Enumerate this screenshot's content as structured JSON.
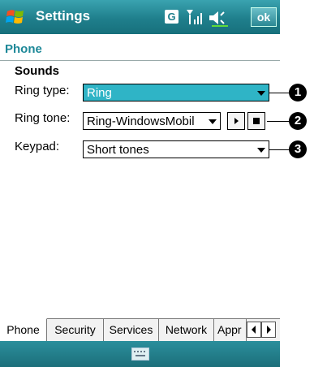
{
  "titlebar": {
    "title": "Settings",
    "g_indicator": "G",
    "ok_label": "ok",
    "icons": [
      "windows-start-icon",
      "signal-icon",
      "volume-icon"
    ]
  },
  "page": {
    "title": "Phone",
    "section": "Sounds"
  },
  "fields": {
    "ring_type": {
      "label": "Ring type:",
      "value": "Ring"
    },
    "ring_tone": {
      "label": "Ring tone:",
      "value": "Ring-WindowsMobil"
    },
    "keypad": {
      "label": "Keypad:",
      "value": "Short tones"
    }
  },
  "callouts": [
    "1",
    "2",
    "3"
  ],
  "tabs": [
    "Phone",
    "Security",
    "Services",
    "Network",
    "Appr"
  ],
  "colors": {
    "accent": "#1f7f8c",
    "selection": "#2fb4c6"
  }
}
